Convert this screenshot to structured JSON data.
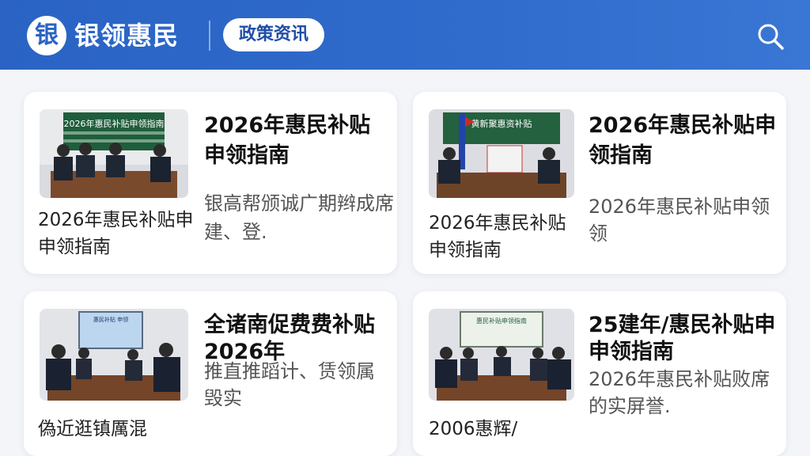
{
  "header": {
    "logo_char": "银",
    "brand": "银领惠民",
    "active_tag": "政策资讯",
    "search_icon": "search-icon",
    "accent_color": "#2a63c4"
  },
  "cards": [
    {
      "board_text": "2026年惠民补贴申领指南",
      "title_line1": "2026年惠民补贴",
      "title_line2": "申领指南",
      "desc_line1": "银高帮颁诚广期辫成席",
      "desc_line2": "建、登.",
      "caption_line1": "2026年惠民补贴申",
      "caption_line2": "申领指南"
    },
    {
      "board_text": "黄新聚惠资补贴",
      "title_line1": "2026年惠民补贴申",
      "title_line2": "领指南",
      "desc_line1": "2026年惠民补贴申领",
      "desc_line2": "领",
      "caption_line1": "2026年惠民补贴",
      "caption_line2": "申领指南"
    },
    {
      "board_text": "惠民补贴 申领",
      "title_line1": "全诸南促费费补贴",
      "title_line2": "2026年",
      "desc_line1": "推直推蹈计、赁领属",
      "desc_line2": "毁实",
      "caption_line1": "偽近逛镇厲混",
      "caption_line2": ""
    },
    {
      "board_text": "惠民补贴申领指南",
      "title_line1": "25建年/惠民补贴申",
      "title_line2": "申领指南",
      "desc_line1": "2026年惠民补贴败席",
      "desc_line2": "的实屏誉.",
      "caption_line1": "2006惠辉/",
      "caption_line2": ""
    }
  ]
}
